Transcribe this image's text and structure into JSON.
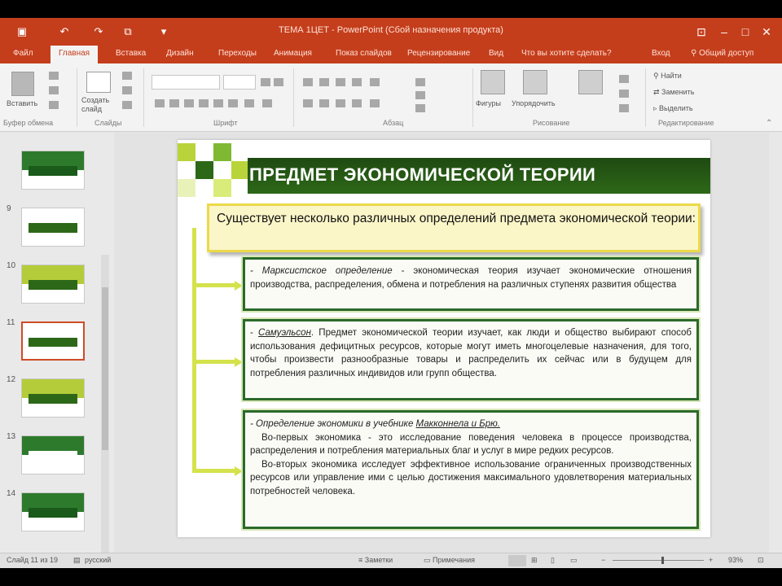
{
  "window": {
    "title": "ТЕМА 1ЦЕТ - PowerPoint (Сбой назначения продукта)",
    "user": "Общий доступ"
  },
  "ribbon_tabs": [
    "Файл",
    "Главная",
    "Вставка",
    "Дизайн",
    "Переходы",
    "Анимация",
    "Показ слайдов",
    "Рецензирование",
    "Вид",
    "Что вы хотите сделать?",
    "Вход"
  ],
  "ribbon": {
    "groups": [
      "Буфер обмена",
      "Слайды",
      "Шрифт",
      "Абзац",
      "Рисование",
      "Редактирование"
    ],
    "buttons": {
      "paste": "Вставить",
      "new_slide": "Создать слайд",
      "shapes": "Фигуры",
      "arrange": "Упорядочить",
      "find": "Найти",
      "replace": "Заменить",
      "select": "Выделить"
    }
  },
  "thumbnails": [
    {
      "num": "",
      "colors": [
        "#2d7a2d",
        "#1a5a1a"
      ],
      "selected": false
    },
    {
      "num": "9",
      "colors": [
        "#ffffff",
        "#2d6818"
      ],
      "selected": false
    },
    {
      "num": "10",
      "colors": [
        "#b5cc3a",
        "#2d6818"
      ],
      "selected": false
    },
    {
      "num": "11",
      "colors": [
        "#ffffff",
        "#2d6818"
      ],
      "selected": true
    },
    {
      "num": "12",
      "colors": [
        "#b5cc3a",
        "#2d6818"
      ],
      "selected": false
    },
    {
      "num": "13",
      "colors": [
        "#2d7a2d",
        "#ffffff"
      ],
      "selected": false
    },
    {
      "num": "14",
      "colors": [
        "#2d7a2d",
        "#1a5a1a"
      ],
      "selected": false
    }
  ],
  "slide": {
    "title": "ПРЕДМЕТ ЭКОНОМИЧЕСКОЙ ТЕОРИИ",
    "intro": "Существует несколько различных определений предмета экономической теории:",
    "def1": {
      "lead": "- Марксистское определение",
      "rest": " - экономическая теория изучает экономические отношения производства, распределения, обмена и потребления на различных ступенях развития общества"
    },
    "def2": {
      "author": "Самуэльсон",
      "rest": ". Предмет экономической теории изучает, как люди и общество выбирают способ использования дефицитных ресурсов, которые могут иметь многоцелевые назначения, для того, чтобы произвести разнообразные товары и распределить их сейчас или в будущем для потребления различных индивидов или групп общества."
    },
    "def3": {
      "lead": "- Определение экономики в учебнике ",
      "authors": "Макконнела и Брю.",
      "p1": "Во-первых экономика - это исследование поведения человека в процессе производства, распределения и потребления материальных благ и услуг в мире редких ресурсов.",
      "p2": "Во-вторых экономика исследует эффективное использование ограниченных производственных ресурсов или управление ими с целью достижения максимального удовлетворения материальных потребностей человека."
    }
  },
  "statusbar": {
    "slide_info": "Слайд 11 из 19",
    "language": "русский",
    "notes": "Заметки",
    "comments": "Примечания",
    "zoom": "93%"
  },
  "colors": {
    "accent": "#c43e1c",
    "title_band": "#2d6818",
    "box_border": "#2b6a2a",
    "intro_fill": "#fbf6c8",
    "connector": "#d4e24c"
  }
}
